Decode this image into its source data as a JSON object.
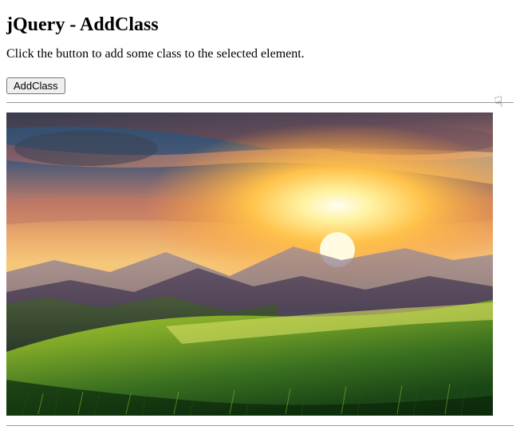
{
  "heading": "jQuery - AddClass",
  "instruction": "Click the button to add some class to the selected element.",
  "button_label": "AddClass",
  "image_alt": "Sunset over mountains with green grassy foreground"
}
